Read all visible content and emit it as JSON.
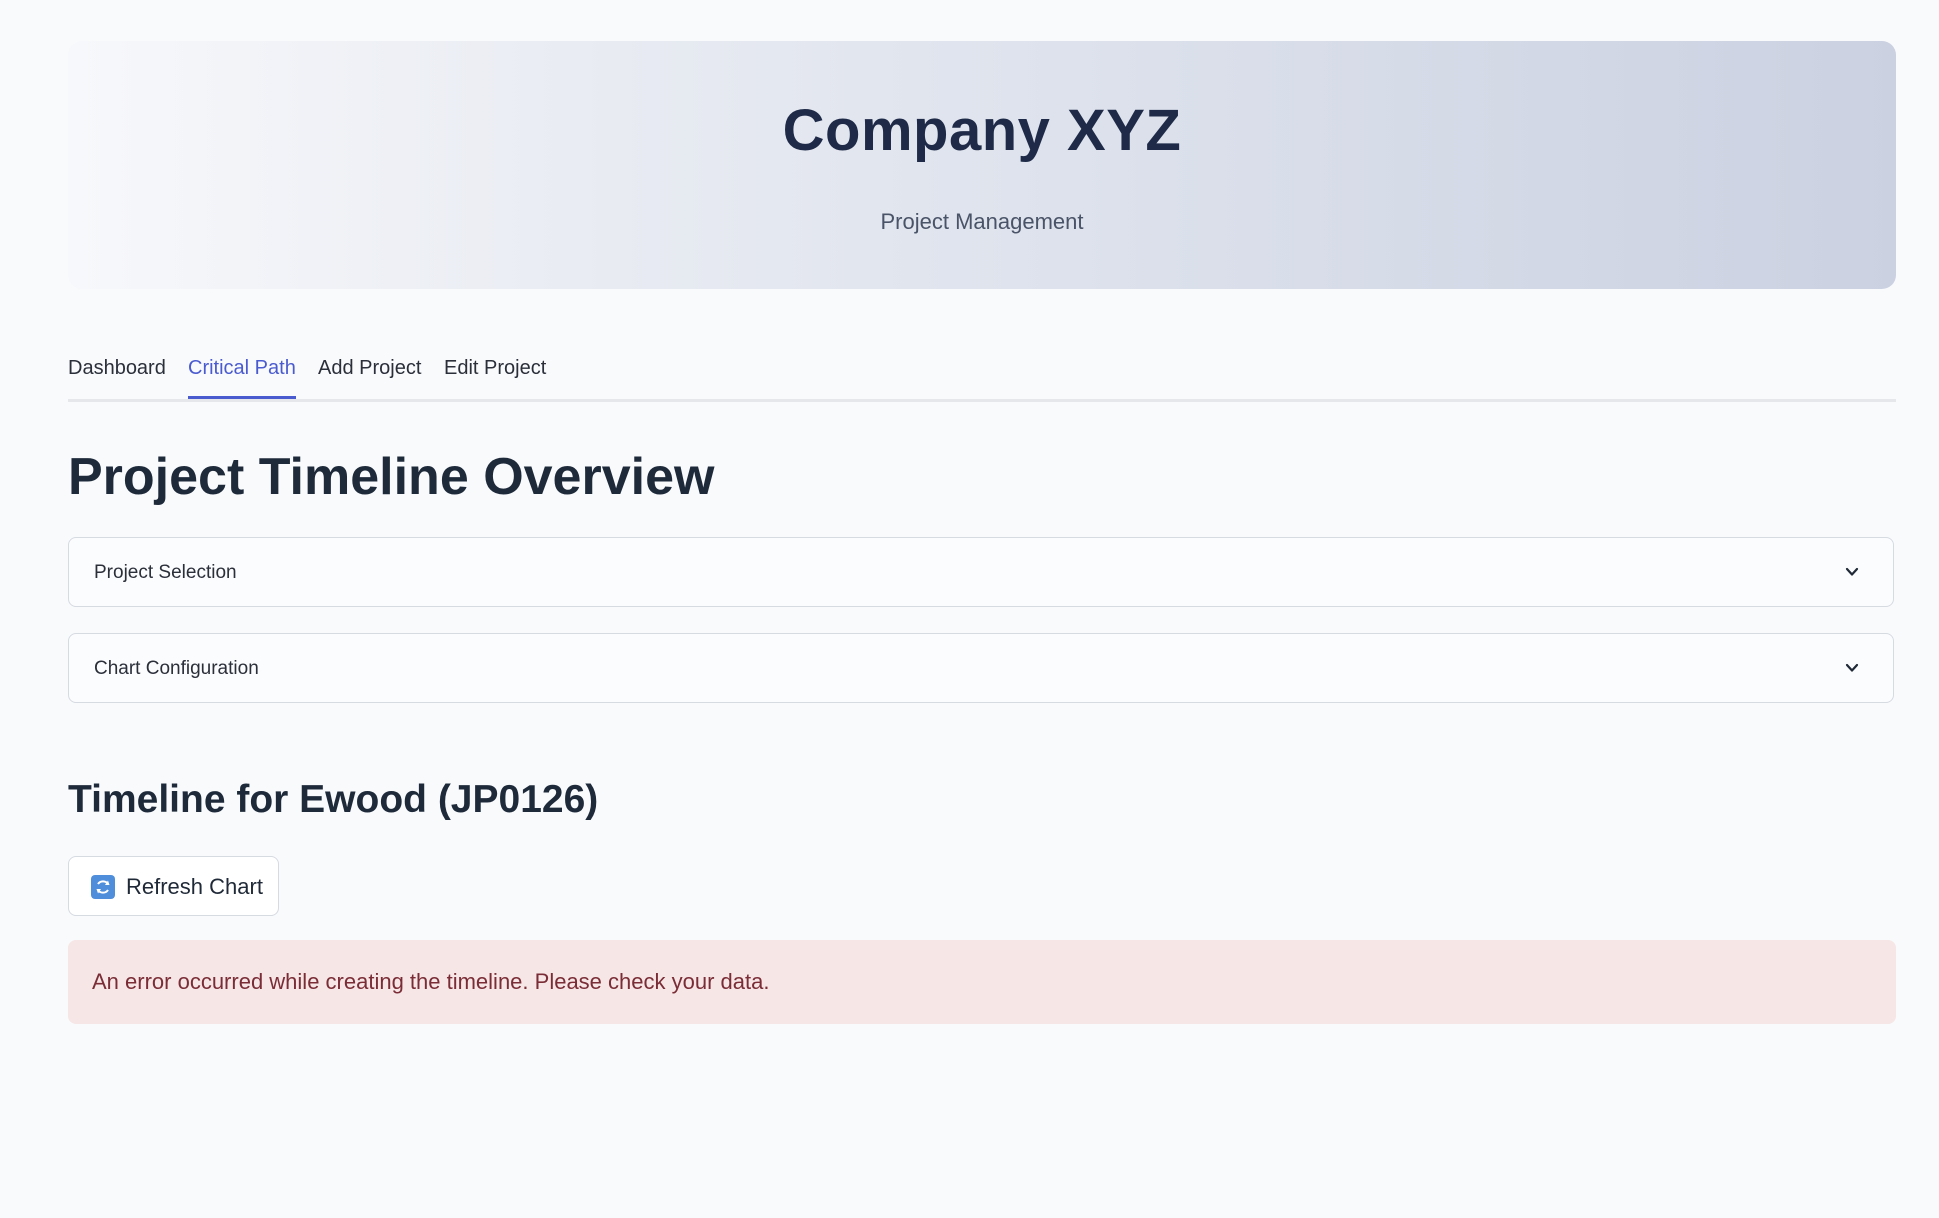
{
  "header": {
    "title": "Company XYZ",
    "subtitle": "Project Management"
  },
  "tabs": [
    {
      "label": "Dashboard",
      "active": false
    },
    {
      "label": "Critical Path",
      "active": true
    },
    {
      "label": "Add Project",
      "active": false
    },
    {
      "label": "Edit Project",
      "active": false
    }
  ],
  "main": {
    "page_title": "Project Timeline Overview",
    "expanders": [
      {
        "label": "Project Selection",
        "icon": "chevron-down-icon"
      },
      {
        "label": "Chart Configuration",
        "icon": "chevron-down-icon"
      }
    ],
    "timeline_title": "Timeline for Ewood (JP0126)",
    "refresh_button": {
      "label": "Refresh Chart",
      "icon": "refresh-icon"
    },
    "error_message": "An error occurred while creating the timeline. Please check your data."
  },
  "colors": {
    "accent": "#4a5bd0",
    "error_bg": "#f6e6e6",
    "error_text": "#7a2d36",
    "refresh_icon": "#4f8edb"
  }
}
